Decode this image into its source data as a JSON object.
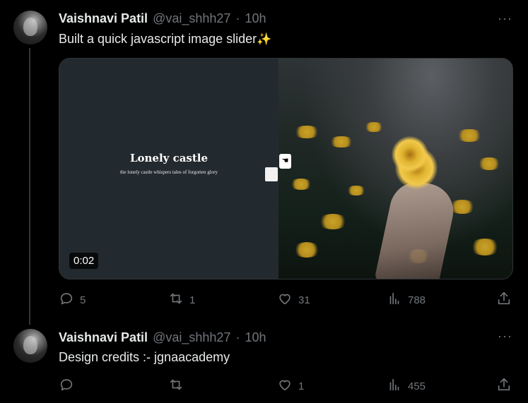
{
  "tweets": [
    {
      "author_name": "Vaishnavi Patil",
      "handle": "@vai_shhh27",
      "separator": "·",
      "time": "10h",
      "more": "···",
      "text": "Built a quick javascript image slider",
      "emoji": "✨",
      "media": {
        "slide_title": "Lonely castle",
        "slide_subtitle": "the lonely castle whispers tales of forgotten glory",
        "video_time": "0:02"
      },
      "actions": {
        "replies": "5",
        "reposts": "1",
        "likes": "31",
        "views": "788"
      }
    },
    {
      "author_name": "Vaishnavi Patil",
      "handle": "@vai_shhh27",
      "separator": "·",
      "time": "10h",
      "more": "···",
      "text": "Design credits :- jgnaacademy",
      "actions": {
        "replies": "",
        "reposts": "",
        "likes": "1",
        "views": "455"
      }
    }
  ],
  "icons": {
    "reply": "reply-icon",
    "repost": "repost-icon",
    "like": "heart-icon",
    "views": "views-icon",
    "share": "share-icon"
  },
  "colors": {
    "background": "#000000",
    "text": "#e7e9ea",
    "muted": "#71767b",
    "thread_line": "#333639"
  }
}
